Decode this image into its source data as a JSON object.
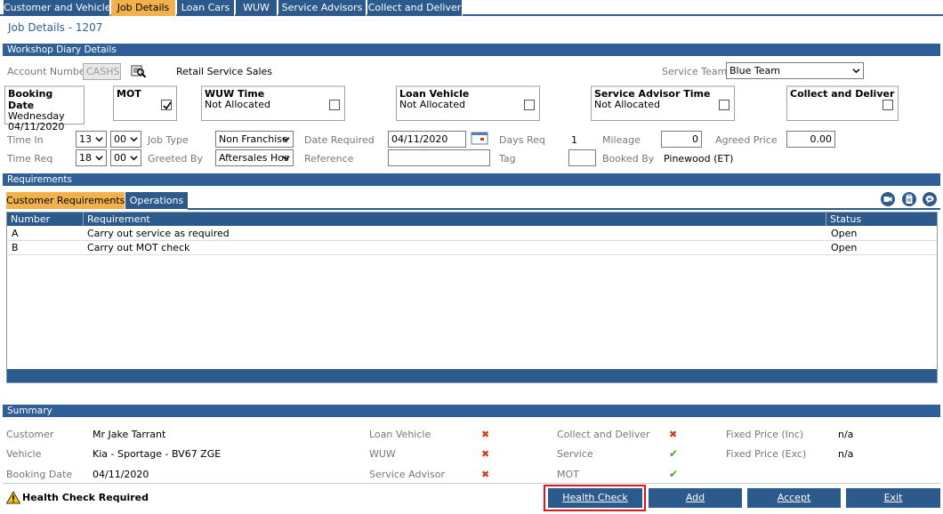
{
  "tabs": [
    "Customer and Vehicle",
    "Job Details",
    "Loan Cars",
    "WUW",
    "Service Advisors",
    "Collect and Deliver"
  ],
  "page_title": "Job Details - 1207",
  "sections": {
    "diary": "Workshop Diary Details",
    "requirements": "Requirements",
    "summary": "Summary"
  },
  "diary": {
    "account_label": "Account Number",
    "account_value": "CASHS",
    "account_name": "Retail Service Sales",
    "service_teams_label": "Service Teams",
    "service_teams_value": "Blue Team",
    "booking_date": {
      "title": "Booking Date",
      "line1": "Wednesday",
      "line2": "04/11/2020"
    },
    "mot": {
      "title": "MOT",
      "checked": true
    },
    "wuw": {
      "title": "WUW Time",
      "line1": "Not Allocated"
    },
    "loan": {
      "title": "Loan Vehicle",
      "line1": "Not Allocated"
    },
    "advisor": {
      "title": "Service Advisor Time",
      "line1": "Not Allocated"
    },
    "collect": {
      "title": "Collect and Deliver"
    },
    "time_in_label": "Time In",
    "time_in_h": "13",
    "time_in_m": "00",
    "time_req_label": "Time Req",
    "time_req_h": "18",
    "time_req_m": "00",
    "job_type_label": "Job Type",
    "job_type_value": "Non Franchise",
    "greeted_label": "Greeted By",
    "greeted_value": "Aftersales Hos",
    "date_required_label": "Date Required",
    "date_required_value": "04/11/2020",
    "reference_label": "Reference",
    "reference_value": "",
    "days_req_label": "Days Req",
    "days_req_value": "1",
    "tag_label": "Tag",
    "tag_value": "",
    "mileage_label": "Mileage",
    "mileage_value": "0",
    "booked_by_label": "Booked By",
    "booked_by_value": "Pinewood (ET)",
    "agreed_price_label": "Agreed Price",
    "agreed_price_value": "0.00"
  },
  "requirements": {
    "subtabs": [
      "Customer Requirements",
      "Operations"
    ],
    "columns": [
      "Number",
      "Requirement",
      "Status"
    ],
    "rows": [
      {
        "number": "A",
        "requirement": "Carry out service as required",
        "status": "Open"
      },
      {
        "number": "B",
        "requirement": "Carry out MOT check",
        "status": "Open"
      }
    ]
  },
  "summary": {
    "customer_label": "Customer",
    "customer_value": "Mr Jake Tarrant",
    "vehicle_label": "Vehicle",
    "vehicle_value": "Kia - Sportage - BV67 ZGE",
    "booking_date_label": "Booking Date",
    "booking_date_value": "04/11/2020",
    "loan_vehicle_label": "Loan Vehicle",
    "wuw_label": "WUW",
    "service_advisor_label": "Service Advisor",
    "collect_label": "Collect and Deliver",
    "service_label": "Service",
    "mot_label": "MOT",
    "fixed_inc_label": "Fixed Price (Inc)",
    "fixed_inc_value": "n/a",
    "fixed_exc_label": "Fixed Price (Exc)",
    "fixed_exc_value": "n/a",
    "cross": "✖",
    "tick": "✔"
  },
  "footer": {
    "warning": "Health Check Required",
    "health_check": "Health Check",
    "add": "Add",
    "accept": "Accept",
    "exit": "Exit"
  },
  "colors": {
    "primary": "#2d5a8c",
    "active_tab": "#f2b24b",
    "highlight": "#e0141e",
    "cross": "#d23a1a",
    "tick": "#4aa832"
  }
}
